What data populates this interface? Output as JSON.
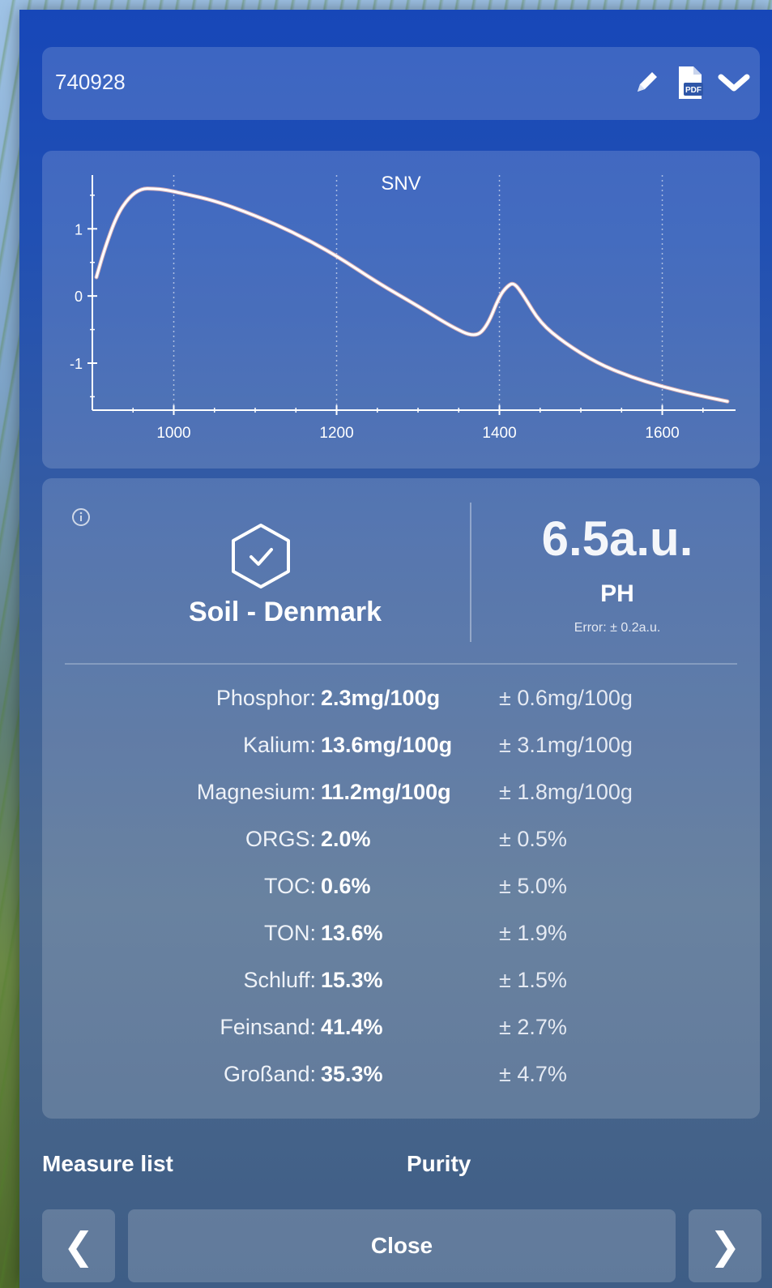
{
  "header": {
    "measurement_id": "740928",
    "icons": [
      "pencil-icon",
      "pdf-file-icon",
      "chevron-down-icon"
    ]
  },
  "chart_data": {
    "type": "line",
    "title": "SNV",
    "xlabel": "",
    "ylabel": "",
    "xlim": [
      900,
      1690
    ],
    "ylim": [
      -1.7,
      1.8
    ],
    "x_ticks": [
      1000,
      1200,
      1400,
      1600
    ],
    "y_ticks": [
      1,
      0,
      -1
    ],
    "grid": "vertical-dotted",
    "series": [
      {
        "x": [
          905,
          915,
          930,
          945,
          960,
          975,
          990,
          1010,
          1050,
          1100,
          1150,
          1200,
          1250,
          1300,
          1340,
          1370,
          1385,
          1400,
          1410,
          1418,
          1430,
          1450,
          1480,
          1520,
          1560,
          1600,
          1640,
          1680
        ],
        "y": [
          0.28,
          0.7,
          1.2,
          1.47,
          1.6,
          1.6,
          1.58,
          1.53,
          1.42,
          1.2,
          0.93,
          0.6,
          0.2,
          -0.15,
          -0.45,
          -0.62,
          -0.45,
          0.0,
          0.15,
          0.2,
          0.0,
          -0.4,
          -0.7,
          -1.0,
          -1.2,
          -1.35,
          -1.47,
          -1.57
        ]
      }
    ]
  },
  "result": {
    "sample_name": "Soil - Denmark",
    "main_value": "6.5a.u.",
    "main_label": "PH",
    "main_error": "Error: ± 0.2a.u.",
    "rows": [
      {
        "label": "Phosphor:",
        "value": "2.3mg/100g",
        "error": "± 0.6mg/100g"
      },
      {
        "label": "Kalium:",
        "value": "13.6mg/100g",
        "error": "± 3.1mg/100g"
      },
      {
        "label": "Magnesium:",
        "value": "11.2mg/100g",
        "error": "± 1.8mg/100g"
      },
      {
        "label": "ORGS:",
        "value": "2.0%",
        "error": "± 0.5%"
      },
      {
        "label": "TOC:",
        "value": "0.6%",
        "error": "± 5.0%"
      },
      {
        "label": "TON:",
        "value": "13.6%",
        "error": "± 1.9%"
      },
      {
        "label": "Schluff:",
        "value": "15.3%",
        "error": "± 1.5%"
      },
      {
        "label": "Feinsand:",
        "value": "41.4%",
        "error": "± 2.7%"
      },
      {
        "label": "Großand:",
        "value": "35.3%",
        "error": "± 4.7%"
      }
    ]
  },
  "footer": {
    "measure_list_label": "Measure list",
    "purity_label": "Purity",
    "prev_label": "❮",
    "close_label": "Close",
    "next_label": "❯"
  },
  "colors": {
    "panel_top": "#1747b8",
    "panel_bottom": "#3e5d86",
    "curve": "#ffffff",
    "curve_shadow": "#f3b9b0"
  }
}
